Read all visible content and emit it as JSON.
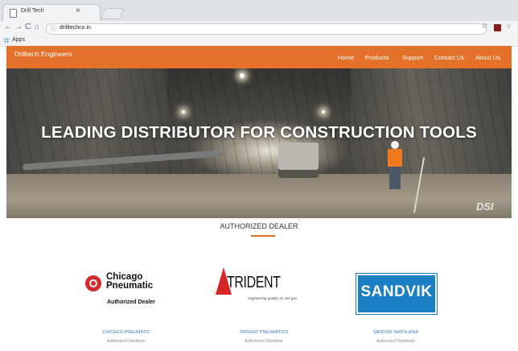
{
  "browser": {
    "tab_title": "Drill Tech",
    "tab_close": "×",
    "url": "drilltechco.in",
    "bookmarks_label": "Apps"
  },
  "site": {
    "brand": "Drilltech Engineers",
    "nav": [
      "Home",
      "Products",
      "Support",
      "Contact Us",
      "About Us"
    ],
    "accent_color": "#e4712a"
  },
  "hero": {
    "title": "LEADING DISTRIBUTOR FOR CONSTRUCTION TOOLS",
    "watermark": "DSI"
  },
  "dealers": {
    "section_title": "AUTHORIZED DEALER",
    "items": [
      {
        "logo_line1": "Chicago",
        "logo_line2": "Pneumatic",
        "logo_caption": "Authorized Dealer",
        "name": "CHICAGO PNEUMATIC",
        "subtitle": "Authorized Distributor"
      },
      {
        "logo_line1": "TRIDENT",
        "logo_caption": "engineering quality air and gas",
        "name": "TRIDENT PNEUMATICS",
        "subtitle": "Authorized Distributor"
      },
      {
        "logo_line1": "SANDVIK",
        "name": "SANDVIK SMITH ASIA",
        "subtitle": "Authorized Distributor"
      }
    ]
  }
}
